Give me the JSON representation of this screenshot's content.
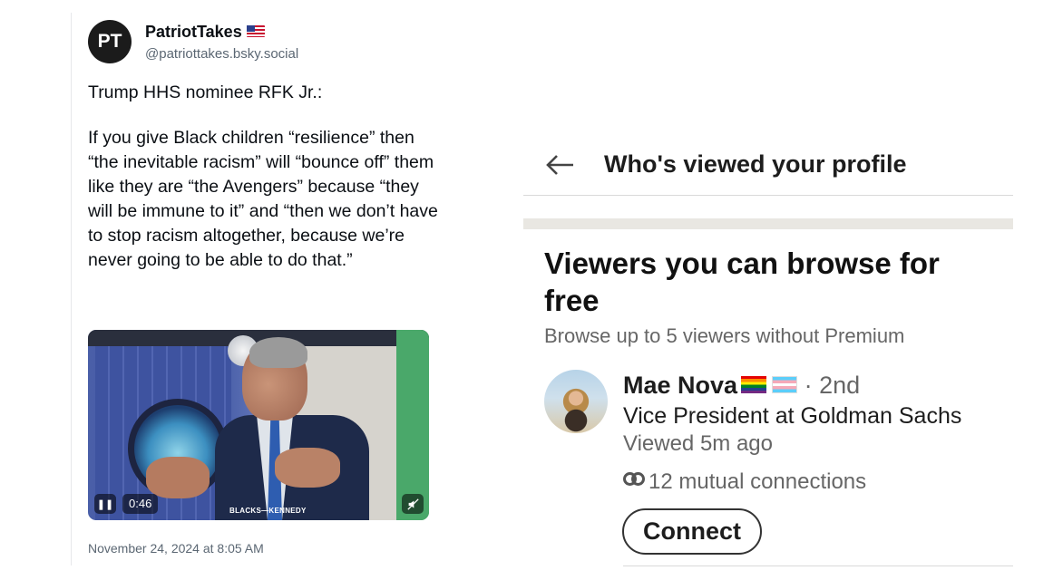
{
  "post": {
    "avatar_text": "PT",
    "display_name": "PatriotTakes",
    "handle": "@patriottakes.bsky.social",
    "text_lead": "Trump HHS nominee RFK Jr.:",
    "text_body": "If you give Black children “resilience” then “the inevitable racism” will “bounce off” them like they are “the Avengers” because “they will be immune to it” and “then we don’t have to stop racism altogether, because we’re never going to be able to do that.”",
    "video": {
      "duration": "0:46",
      "caption": "BLACKS—KENNEDY",
      "pause_icon": "pause-icon",
      "mute_icon": "muted-speaker-icon"
    },
    "timestamp": "November 24, 2024 at 8:05 AM",
    "flag_icon": "us-flag-icon"
  },
  "linkedin": {
    "page_title": "Who's viewed your profile",
    "section_heading": "Viewers you can browse for free",
    "section_sub": "Browse up to 5 viewers without Premium",
    "viewer": {
      "name": "Mae Nova",
      "degree": "· 2nd",
      "headline": "Vice President at Goldman Sachs",
      "viewed": "Viewed 5m ago",
      "mutual": "12 mutual connections",
      "connect_label": "Connect",
      "flag_icons": [
        "pride-flag-icon",
        "transgender-flag-icon"
      ]
    }
  }
}
